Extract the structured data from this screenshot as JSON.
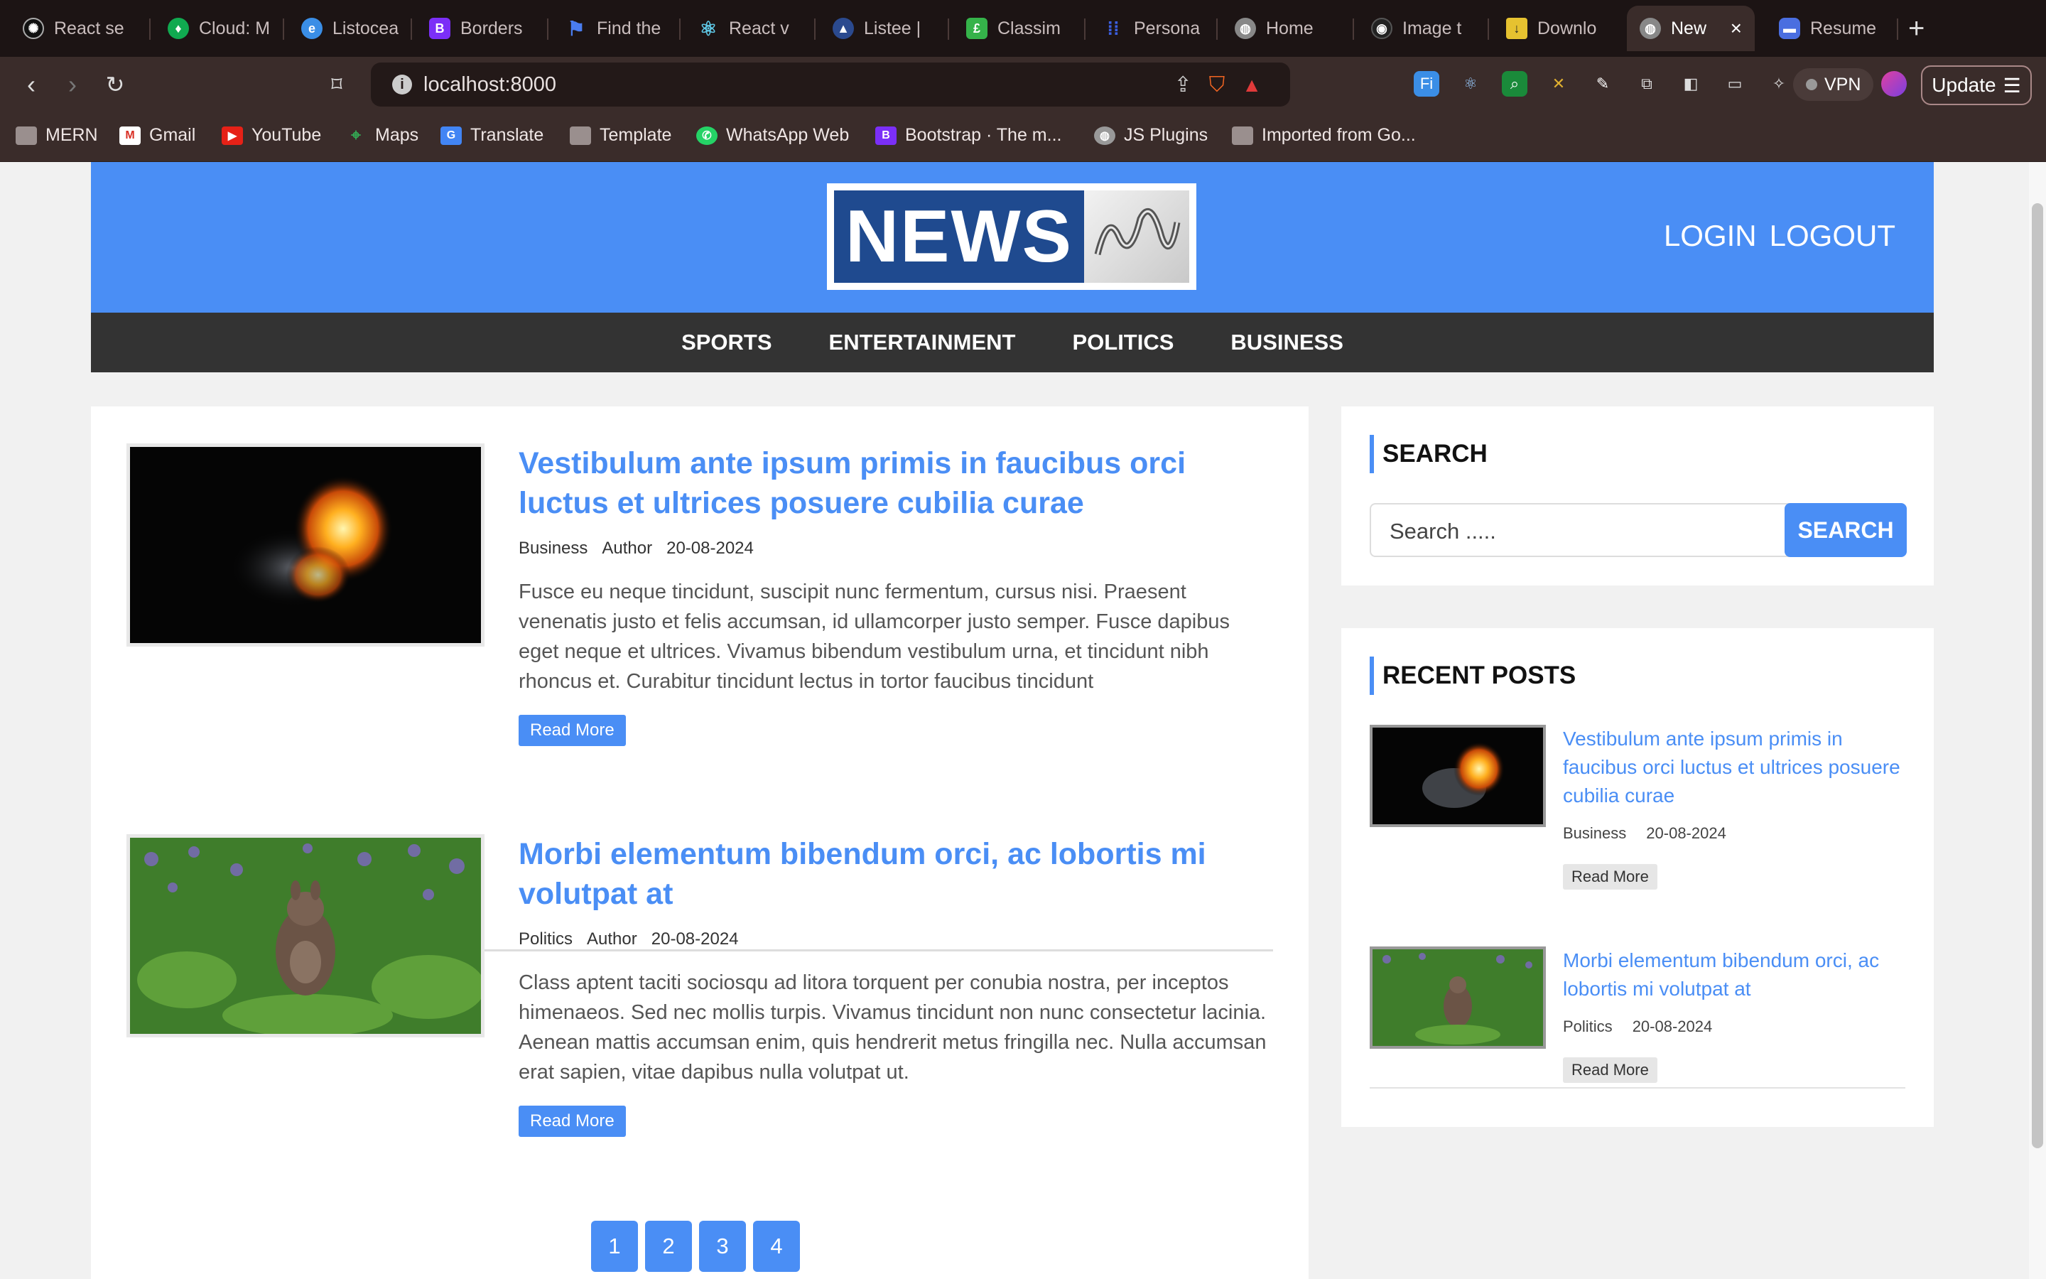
{
  "browser": {
    "tabs": [
      {
        "label": "React se",
        "icon": "chatgpt-icon",
        "color": "#111111"
      },
      {
        "label": "Cloud: M",
        "icon": "mongodb-icon",
        "color": "#10aa50"
      },
      {
        "label": "Listocea",
        "icon": "edge-icon",
        "color": "#3a8ee6"
      },
      {
        "label": "Borders",
        "icon": "bootstrap-icon",
        "color": "#7b2ff7"
      },
      {
        "label": "Find the",
        "icon": "flag-icon",
        "color": "#4a7df0"
      },
      {
        "label": "React v",
        "icon": "react-icon",
        "color": "#5fc8e6"
      },
      {
        "label": "Listee |",
        "icon": "listee-icon",
        "color": "#2b4a8f"
      },
      {
        "label": "Classim",
        "icon": "classim-icon",
        "color": "#35b34a"
      },
      {
        "label": "Persona",
        "icon": "grid-icon",
        "color": "#3b5fe0"
      },
      {
        "label": "Home",
        "icon": "globe-icon",
        "color": "#888888"
      },
      {
        "label": "Image t",
        "icon": "image-icon",
        "color": "#222222"
      },
      {
        "label": "Downlo",
        "icon": "download-icon",
        "color": "#e6c230"
      },
      {
        "label": "New",
        "icon": "globe-icon",
        "color": "#888888",
        "active": true
      },
      {
        "label": "Resume",
        "icon": "resume-icon",
        "color": "#4a6ee0"
      }
    ],
    "url": "localhost:8000",
    "vpn_label": "VPN",
    "update_label": "Update",
    "bookmarks": [
      {
        "label": "MERN",
        "icon": "folder-icon"
      },
      {
        "label": "Gmail",
        "icon": "gmail-icon"
      },
      {
        "label": "YouTube",
        "icon": "youtube-icon"
      },
      {
        "label": "Maps",
        "icon": "maps-icon"
      },
      {
        "label": "Translate",
        "icon": "translate-icon"
      },
      {
        "label": "Template",
        "icon": "folder-icon"
      },
      {
        "label": "WhatsApp Web",
        "icon": "whatsapp-icon"
      },
      {
        "label": "Bootstrap · The m...",
        "icon": "bootstrap-icon"
      },
      {
        "label": "JS Plugins",
        "icon": "globe-icon"
      },
      {
        "label": "Imported from Go...",
        "icon": "folder-icon"
      }
    ]
  },
  "site": {
    "logo_text": "NEWS",
    "login": "LOGIN",
    "logout": "LOGOUT",
    "categories": [
      "SPORTS",
      "ENTERTAINMENT",
      "POLITICS",
      "BUSINESS"
    ],
    "accent": "#4a8ef5"
  },
  "posts": [
    {
      "title": "Vestibulum ante ipsum primis in faucibus orci luctus et ultrices posuere cubilia curae",
      "category": "Business",
      "author": "Author",
      "date": "20-08-2024",
      "excerpt": "Fusce eu neque tincidunt, suscipit nunc fermentum, cursus nisi. Praesent venenatis justo et felis accumsan, id ullamcorper justo semper. Fusce dapibus eget neque et ultrices. Vivamus bibendum vestibulum urna, et tincidunt nibh rhoncus et. Curabitur tincidunt lectus in tortor faucibus tincidunt",
      "read_more": "Read More",
      "image": "fire-explosion-image"
    },
    {
      "title": "Morbi elementum bibendum orci, ac lobortis mi volutpat at",
      "category": "Politics",
      "author": "Author",
      "date": "20-08-2024",
      "excerpt": "Class aptent taciti sociosqu ad litora torquent per conubia nostra, per inceptos himenaeos. Sed nec mollis turpis. Vivamus tincidunt non nunc consectetur lacinia. Aenean mattis accumsan enim, quis hendrerit metus fringilla nec. Nulla accumsan erat sapien, vitae dapibus nulla volutpat ut.",
      "read_more": "Read More",
      "image": "wallaby-in-flowers-image"
    }
  ],
  "pagination": [
    "1",
    "2",
    "3",
    "4"
  ],
  "sidebar": {
    "search": {
      "title": "SEARCH",
      "placeholder": "Search .....",
      "button": "SEARCH"
    },
    "recent": {
      "title": "RECENT POSTS",
      "items": [
        {
          "title": "Vestibulum ante ipsum primis in faucibus orci luctus et ultrices posuere cubilia curae",
          "category": "Business",
          "date": "20-08-2024",
          "read_more": "Read More"
        },
        {
          "title": "Morbi elementum bibendum orci, ac lobortis mi volutpat at",
          "category": "Politics",
          "date": "20-08-2024",
          "read_more": "Read More"
        }
      ]
    }
  }
}
